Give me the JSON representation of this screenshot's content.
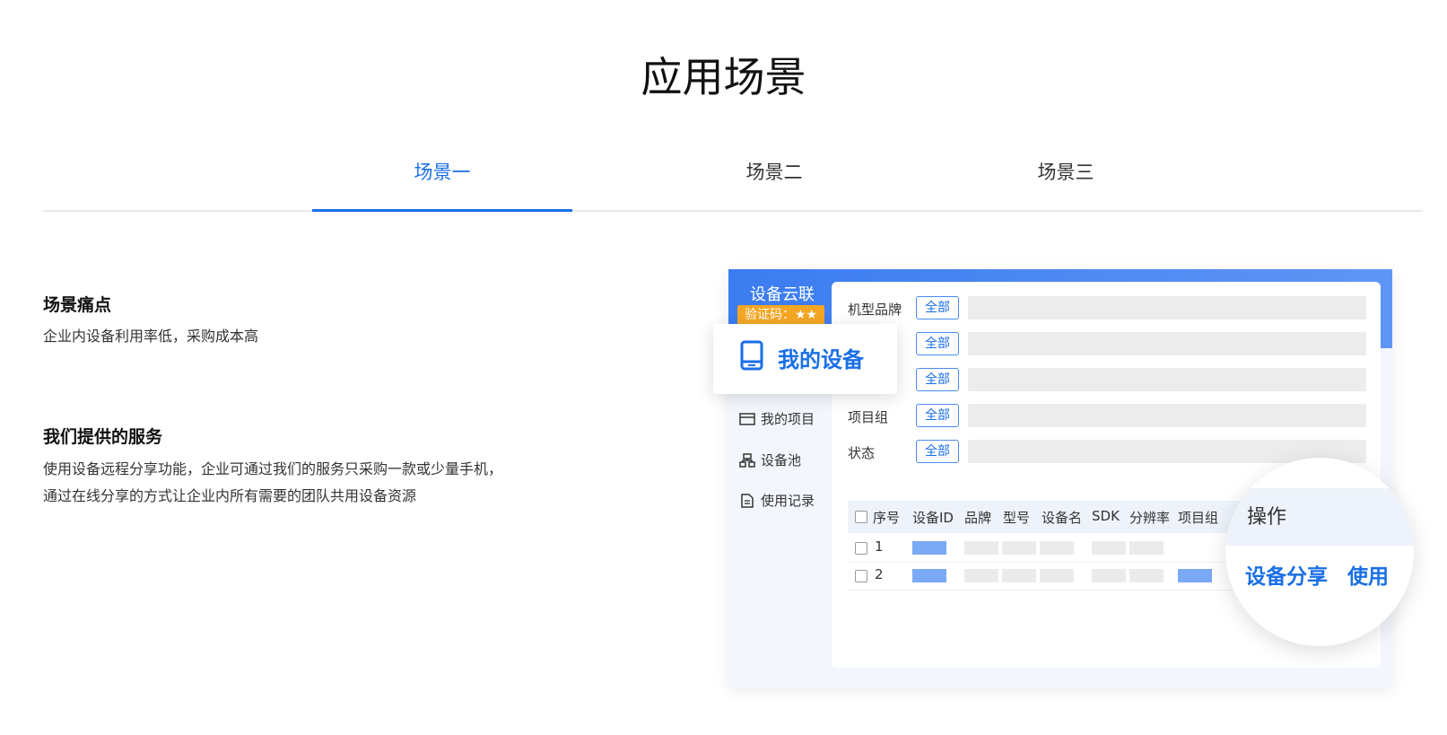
{
  "page": {
    "title": "应用场景"
  },
  "tabs": [
    {
      "label": "场景一",
      "active": true
    },
    {
      "label": "场景二",
      "active": false
    },
    {
      "label": "场景三",
      "active": false
    }
  ],
  "pain_point": {
    "title": "场景痛点",
    "text": "企业内设备利用率低，采购成本高"
  },
  "service": {
    "title": "我们提供的服务",
    "lines": [
      "使用设备远程分享功能，企业可通过我们的服务只采购一款或少量手机，",
      "通过在线分享的方式让企业内所有需要的团队共用设备资源"
    ]
  },
  "illustration": {
    "brand": "设备云联",
    "verify_badge": "验证码：★★",
    "popup_label": "我的设备",
    "nav": [
      {
        "label": "我的项目",
        "icon": "project-icon"
      },
      {
        "label": "设备池",
        "icon": "device-pool-icon"
      },
      {
        "label": "使用记录",
        "icon": "record-icon"
      }
    ],
    "filters": [
      {
        "label": "机型品牌",
        "tag": "全部"
      },
      {
        "label": "",
        "tag": "全部"
      },
      {
        "label": "",
        "tag": "全部"
      },
      {
        "label": "项目组",
        "tag": "全部"
      },
      {
        "label": "状态",
        "tag": "全部"
      }
    ],
    "columns": [
      "序号",
      "设备ID",
      "品牌",
      "型号",
      "设备名",
      "SDK",
      "分辨率",
      "项目组"
    ],
    "rows": [
      "1",
      "2"
    ],
    "ops": {
      "header": "操作",
      "share": "设备分享",
      "use": "使用"
    }
  },
  "colors": {
    "accent": "#1a6fe6",
    "badge": "#f5a623"
  }
}
